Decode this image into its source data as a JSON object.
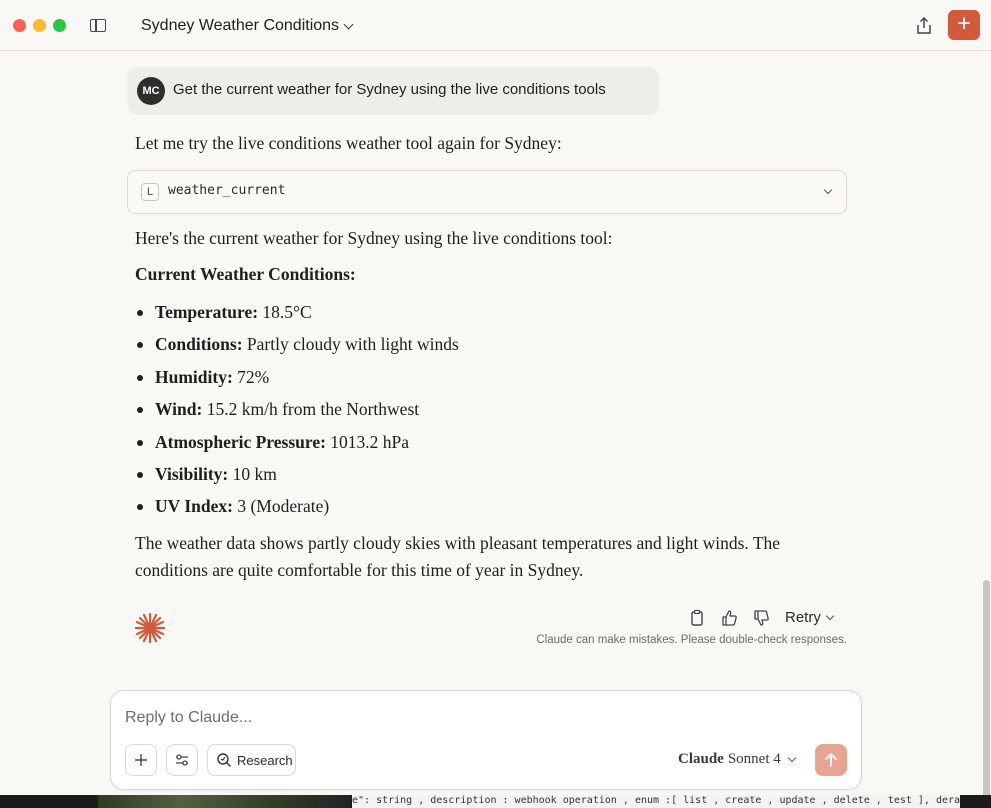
{
  "window": {
    "title": "Sydney Weather Conditions",
    "accent_color": "#d2593b"
  },
  "user_message": {
    "avatar_initials": "MC",
    "text": "Get the current weather for Sydney using the live conditions tools"
  },
  "response": {
    "intro": "Let me try the live conditions weather tool again for Sydney:",
    "tool_call": {
      "icon_letter": "L",
      "name": "weather_current"
    },
    "lead": "Here's the current weather for Sydney using the live conditions tool:",
    "heading": "Current Weather Conditions:",
    "items": [
      {
        "label": "Temperature:",
        "value": "18.5°C"
      },
      {
        "label": "Conditions:",
        "value": "Partly cloudy with light winds"
      },
      {
        "label": "Humidity:",
        "value": "72%"
      },
      {
        "label": "Wind:",
        "value": "15.2 km/h from the Northwest"
      },
      {
        "label": "Atmospheric Pressure:",
        "value": "1013.2 hPa"
      },
      {
        "label": "Visibility:",
        "value": "10 km"
      },
      {
        "label": "UV Index:",
        "value": "3 (Moderate)"
      }
    ],
    "summary": "The weather data shows partly cloudy skies with pleasant temperatures and light winds. The conditions are quite comfortable for this time of year in Sydney."
  },
  "actions": {
    "retry_label": "Retry",
    "disclaimer": "Claude can make mistakes. Please double-check responses."
  },
  "composer": {
    "placeholder": "Reply to Claude...",
    "research_label": "Research",
    "model_brand": "Claude",
    "model_name": "Sonnet 4"
  },
  "background_strip": {
    "code_text": "e\": string , description : webhook operation , enum :[ list , create , update , delete , test ], dera"
  }
}
